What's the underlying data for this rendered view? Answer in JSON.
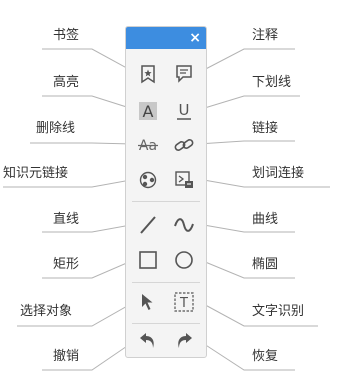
{
  "toolbar": {
    "close_label": "×",
    "titlebar_color": "#3d8de0",
    "icon_color": "#555555",
    "tools": [
      {
        "id": "bookmark",
        "label": "书签",
        "icon": "bookmark-icon"
      },
      {
        "id": "annotation",
        "label": "注释",
        "icon": "note-icon"
      },
      {
        "id": "highlight",
        "label": "高亮",
        "icon": "highlight-icon",
        "glyph": "A"
      },
      {
        "id": "underline",
        "label": "下划线",
        "icon": "underline-icon",
        "glyph": "U"
      },
      {
        "id": "strikethrough",
        "label": "删除线",
        "icon": "strikethrough-icon",
        "glyph": "Aa"
      },
      {
        "id": "link",
        "label": "链接",
        "icon": "link-icon"
      },
      {
        "id": "knowledge-link",
        "label": "知识元链接",
        "icon": "knowledge-link-icon"
      },
      {
        "id": "word-link",
        "label": "划词连接",
        "icon": "word-link-icon"
      },
      {
        "id": "line",
        "label": "直线",
        "icon": "straight-line-icon"
      },
      {
        "id": "curve",
        "label": "曲线",
        "icon": "curve-icon"
      },
      {
        "id": "rectangle",
        "label": "矩形",
        "icon": "rectangle-icon"
      },
      {
        "id": "ellipse",
        "label": "椭圆",
        "icon": "ellipse-icon"
      },
      {
        "id": "select",
        "label": "选择对象",
        "icon": "cursor-arrow-icon"
      },
      {
        "id": "ocr",
        "label": "文字识别",
        "icon": "text-recognition-icon",
        "glyph": "T"
      },
      {
        "id": "undo",
        "label": "撤销",
        "icon": "undo-icon"
      },
      {
        "id": "redo",
        "label": "恢复",
        "icon": "redo-icon"
      }
    ]
  }
}
